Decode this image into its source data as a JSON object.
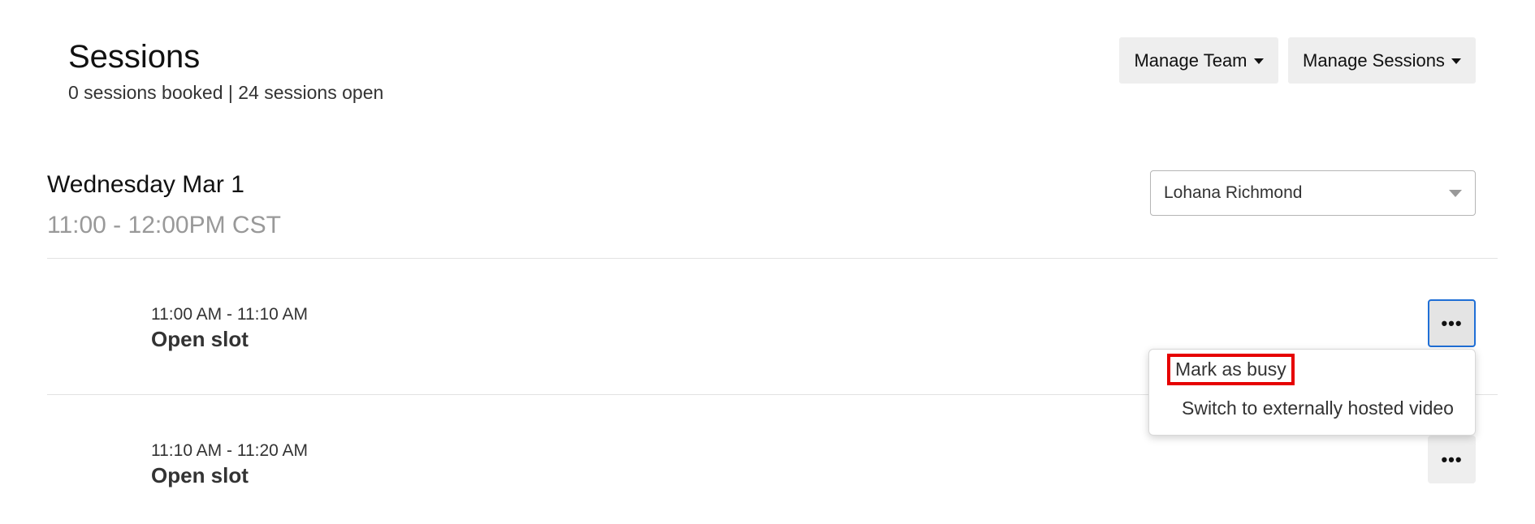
{
  "header": {
    "title": "Sessions",
    "subtitle": "0 sessions booked | 24 sessions open",
    "manage_team_label": "Manage Team",
    "manage_sessions_label": "Manage Sessions"
  },
  "day": {
    "title": "Wednesday Mar 1",
    "time_range": "11:00 - 12:00PM CST",
    "host_select_value": "Lohana Richmond"
  },
  "slots": [
    {
      "time": "11:00 AM - 11:10 AM",
      "status": "Open slot",
      "more_label": "•••"
    },
    {
      "time": "11:10 AM - 11:20 AM",
      "status": "Open slot",
      "more_label": "•••"
    }
  ],
  "menu": {
    "items": [
      {
        "label": "Mark as busy"
      },
      {
        "label": "Switch to externally hosted video"
      }
    ]
  },
  "colors": {
    "button_bg": "#eeeeee",
    "focus_ring": "#1f6fd6",
    "highlight": "#e60000",
    "muted_text": "#999999"
  }
}
